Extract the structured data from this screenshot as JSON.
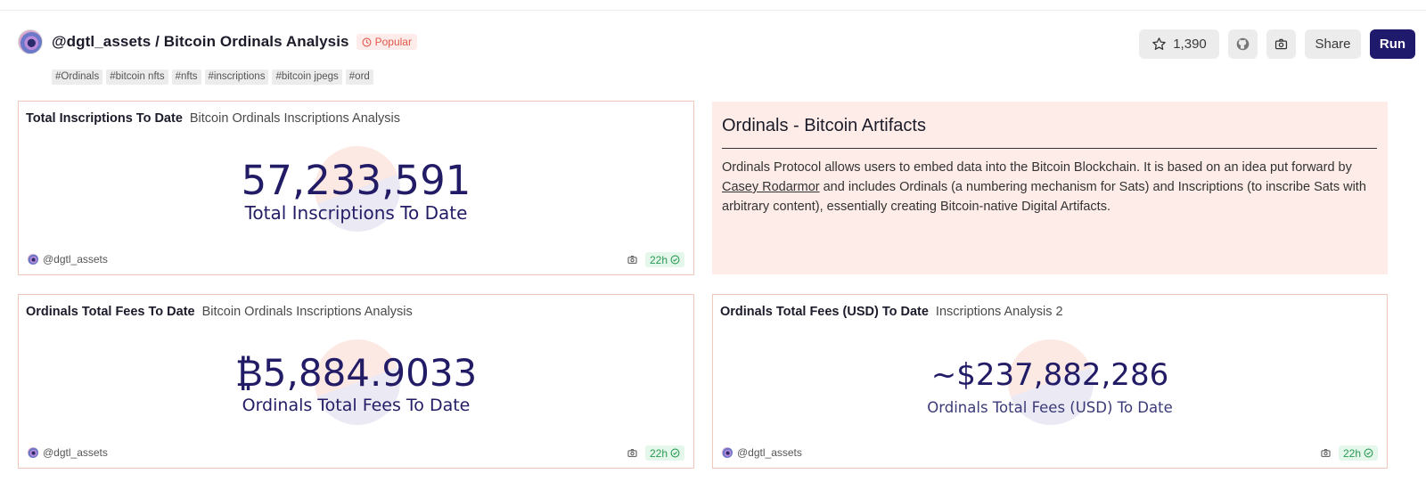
{
  "header": {
    "title": "@dgtl_assets / Bitcoin Ordinals Analysis",
    "badge": "Popular",
    "tags": [
      "#Ordinals",
      "#bitcoin nfts",
      "#nfts",
      "#inscriptions",
      "#bitcoin jpegs",
      "#ord"
    ]
  },
  "actions": {
    "star_count": "1,390",
    "share_label": "Share",
    "run_label": "Run"
  },
  "cards": {
    "inscriptions": {
      "title": "Total Inscriptions To Date",
      "subtitle": "Bitcoin Ordinals Inscriptions Analysis",
      "value": "57,233,591",
      "value_label": "Total Inscriptions To Date",
      "user": "@dgtl_assets",
      "freshness": "22h"
    },
    "fees": {
      "title": "Ordinals Total Fees To Date",
      "subtitle": "Bitcoin Ordinals Inscriptions Analysis",
      "value": "₿5,884.9033",
      "value_label": "Ordinals Total Fees To Date",
      "user": "@dgtl_assets",
      "freshness": "22h"
    },
    "fees_usd": {
      "title": "Ordinals Total Fees (USD) To Date",
      "subtitle": "Inscriptions Analysis 2",
      "value": "~$237,882,286",
      "value_label": "Ordinals Total Fees (USD) To Date",
      "user": "@dgtl_assets",
      "freshness": "22h"
    }
  },
  "text_card": {
    "heading": "Ordinals - Bitcoin Artifacts",
    "body_before": "Ordinals Protocol allows users to embed data into the Bitcoin Blockchain. It is based on an idea put forward by ",
    "link": "Casey Rodarmor",
    "body_after": " and includes Ordinals (a numbering mechanism for Sats) and Inscriptions (to inscribe Sats with arbitrary content), essentially creating Bitcoin-native Digital Artifacts."
  },
  "colors": {
    "accent": "#1f1a6b",
    "card_border": "#f2c8bd",
    "text_card_bg": "#fdece7",
    "fresh_green": "#2c9a55",
    "popular_red": "#e0584a"
  }
}
